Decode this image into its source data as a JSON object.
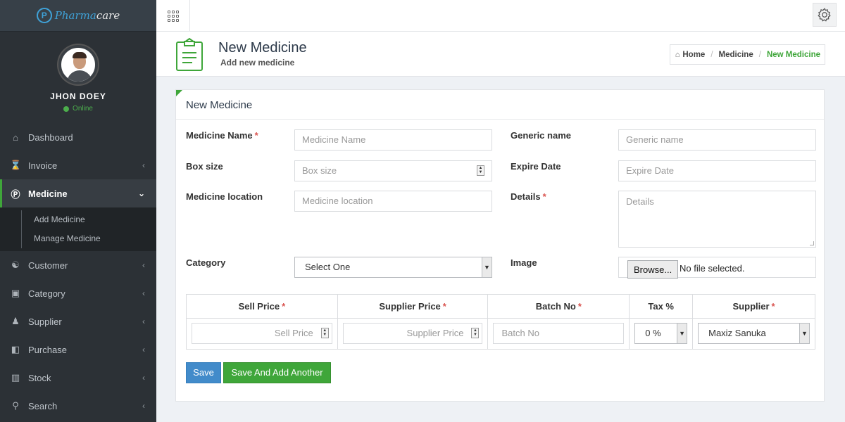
{
  "app": {
    "logo_prefix": "Pharma",
    "logo_suffix": "care"
  },
  "user": {
    "name": "JHON DOEY",
    "status": "Online"
  },
  "sidebar": {
    "items": [
      {
        "label": "Dashboard",
        "icon": "home-icon"
      },
      {
        "label": "Invoice",
        "icon": "hourglass-icon"
      },
      {
        "label": "Medicine",
        "icon": "pill-icon"
      },
      {
        "label": "Customer",
        "icon": "handshake-icon"
      },
      {
        "label": "Category",
        "icon": "cart-icon"
      },
      {
        "label": "Supplier",
        "icon": "person-icon"
      },
      {
        "label": "Purchase",
        "icon": "documents-icon"
      },
      {
        "label": "Stock",
        "icon": "bar-chart-icon"
      },
      {
        "label": "Search",
        "icon": "search-icon"
      }
    ],
    "submenu": [
      "Add Medicine",
      "Manage Medicine"
    ]
  },
  "header": {
    "title": "New Medicine",
    "subtitle": "Add new medicine",
    "breadcrumb": {
      "home": "Home",
      "parent": "Medicine",
      "current": "New Medicine"
    }
  },
  "form": {
    "panel_title": "New Medicine",
    "medicine_name": {
      "label": "Medicine Name",
      "placeholder": "Medicine Name"
    },
    "generic_name": {
      "label": "Generic name",
      "placeholder": "Generic name"
    },
    "box_size": {
      "label": "Box size",
      "placeholder": "Box size"
    },
    "expire_date": {
      "label": "Expire Date",
      "placeholder": "Expire Date"
    },
    "location": {
      "label": "Medicine location",
      "placeholder": "Medicine location"
    },
    "details": {
      "label": "Details",
      "placeholder": "Details"
    },
    "category": {
      "label": "Category",
      "value": "Select One"
    },
    "image": {
      "label": "Image",
      "button": "Browse...",
      "status": "No file selected."
    },
    "required_mark": "*"
  },
  "table": {
    "headers": [
      "Sell Price",
      "Supplier Price",
      "Batch No",
      "Tax %",
      "Supplier"
    ],
    "sell_price_placeholder": "Sell Price",
    "supplier_price_placeholder": "Supplier Price",
    "batch_placeholder": "Batch No",
    "tax_value": "0 %",
    "supplier_value": "Maxiz Sanuka"
  },
  "buttons": {
    "save": "Save",
    "save_add": "Save And Add Another"
  },
  "colors": {
    "accent": "#3fa63a",
    "primary": "#428bca",
    "sidebar": "#2c3136",
    "logo": "#3fa2d8",
    "required": "#d9534f"
  }
}
